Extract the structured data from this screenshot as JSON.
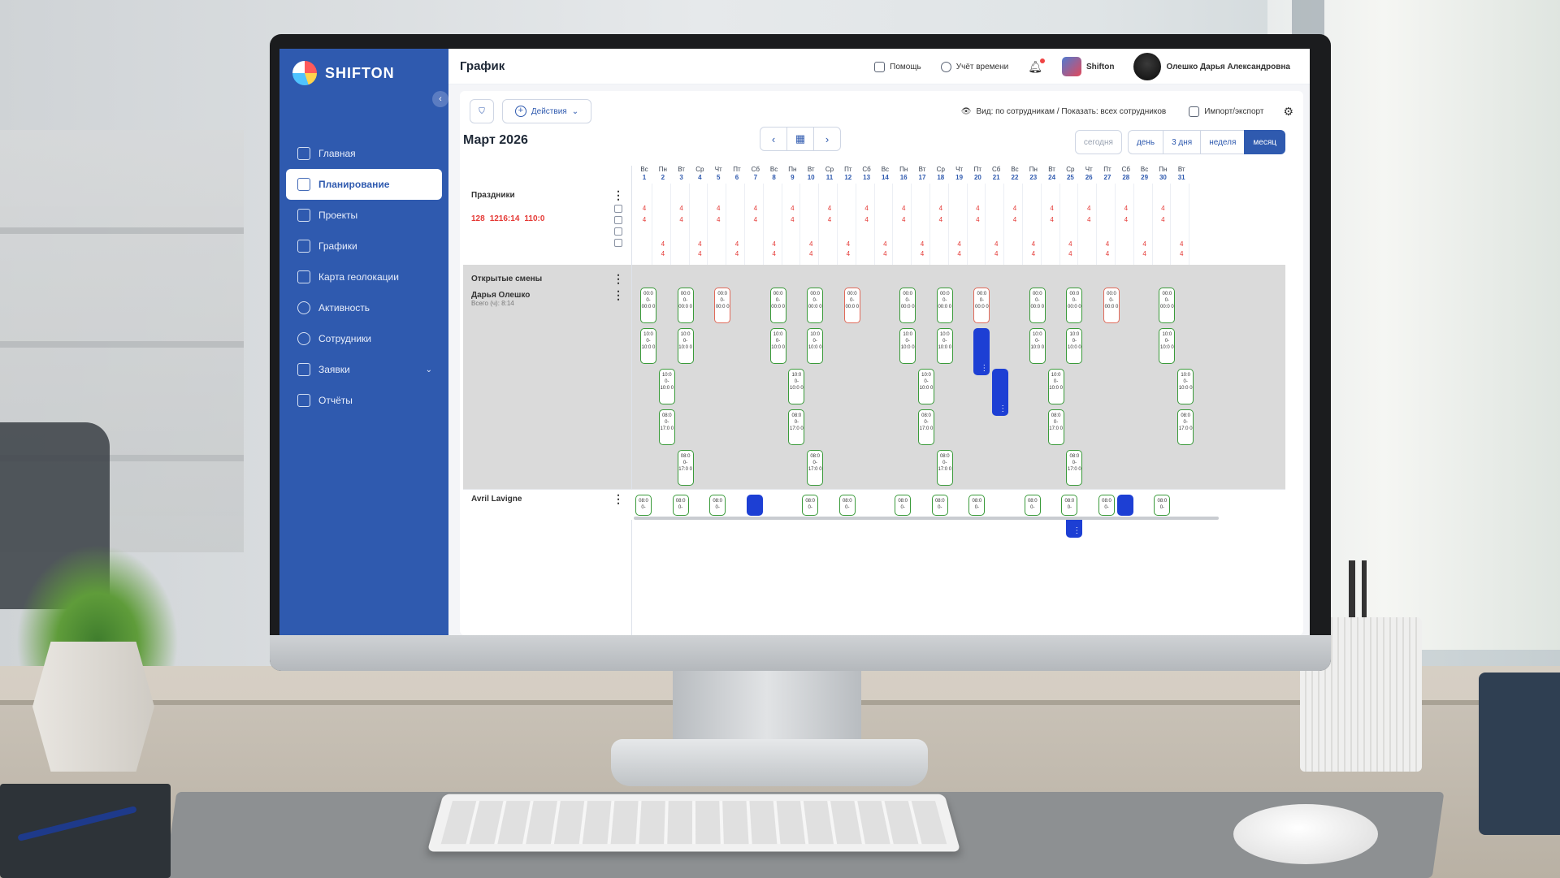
{
  "app": {
    "brand": "SHIFTON",
    "page_title": "График"
  },
  "sidebar": {
    "items": [
      {
        "label": "Главная",
        "icon": "home-icon"
      },
      {
        "label": "Планирование",
        "icon": "calendar-icon",
        "active": true
      },
      {
        "label": "Проекты",
        "icon": "briefcase-icon"
      },
      {
        "label": "Графики",
        "icon": "schedule-icon"
      },
      {
        "label": "Карта геолокации",
        "icon": "map-icon"
      },
      {
        "label": "Активность",
        "icon": "clock-icon"
      },
      {
        "label": "Сотрудники",
        "icon": "users-icon"
      },
      {
        "label": "Заявки",
        "icon": "requests-icon",
        "has_submenu": true
      },
      {
        "label": "Отчёты",
        "icon": "reports-icon"
      }
    ]
  },
  "header": {
    "help": "Помощь",
    "time_tracking": "Учёт времени",
    "company": "Shifton",
    "user": "Олешко Дарья Александровна"
  },
  "toolbar": {
    "actions": "Действия",
    "view_info": "Вид: по сотрудникам / Показать: всех сотрудников",
    "import_export": "Импорт/экспорт"
  },
  "calendar": {
    "month": "Март 2026",
    "views": {
      "today": "сегодня",
      "day": "день",
      "three_days": "3 дня",
      "week": "неделя",
      "month": "месяц"
    },
    "weekdays": [
      "Вс",
      "Пн",
      "Вт",
      "Ср",
      "Чт",
      "Пт",
      "Сб",
      "Вс",
      "Пн",
      "Вт",
      "Ср",
      "Пт",
      "Сб",
      "Вс",
      "Пн",
      "Вт",
      "Ср",
      "Чт",
      "Пт",
      "Сб",
      "Вс",
      "Пн",
      "Вт",
      "Ср",
      "Чт",
      "Пт",
      "Сб",
      "Вс",
      "Пн",
      "Вт"
    ],
    "dates": [
      "1",
      "2",
      "3",
      "4",
      "5",
      "6",
      "7",
      "8",
      "9",
      "10",
      "11",
      "12",
      "13",
      "14",
      "16",
      "17",
      "18",
      "19",
      "20",
      "21",
      "22",
      "23",
      "24",
      "25",
      "26",
      "27",
      "28",
      "29",
      "30",
      "31"
    ]
  },
  "rows": {
    "holidays": "Праздники",
    "stats": {
      "days": "128",
      "hours": "1216:14",
      "other": "110:0"
    },
    "open_shifts": "Открытые смены",
    "employee1": {
      "name": "Дарья Олешко",
      "total": "Всего (ч): 8:14"
    },
    "employee2": {
      "name": "Avril Lavigne"
    }
  },
  "shift_labels": {
    "a": "00:0 0- 00:0 0",
    "b": "10:0 0- 10:0 0",
    "c": "08:0 0- 17:0 0",
    "short": "08:0 0-"
  },
  "colors": {
    "sidebar": "#2f5aaf",
    "accent": "#2f5aaf",
    "shift_border": "#3a9a3a",
    "shift_alert": "#e06a5a",
    "shift_filled": "#1d3fd4",
    "holiday_text": "#e53935"
  }
}
